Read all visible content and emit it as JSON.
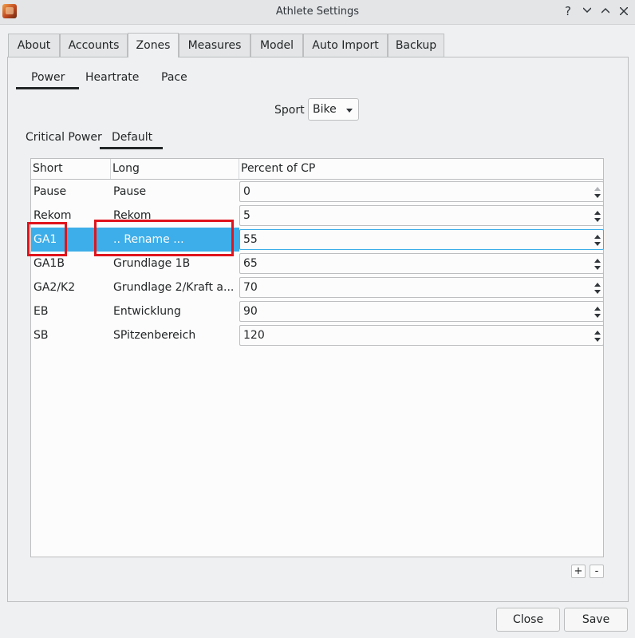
{
  "window": {
    "title": "Athlete Settings",
    "help": "?"
  },
  "tabs": [
    "About",
    "Accounts",
    "Zones",
    "Measures",
    "Model",
    "Auto Import",
    "Backup"
  ],
  "zone_tabs": [
    "Power",
    "Heartrate",
    "Pace"
  ],
  "sport": {
    "label": "Sport",
    "value": "Bike"
  },
  "range_tabs": [
    "Critical Power",
    "Default"
  ],
  "table": {
    "headers": [
      "Short",
      "Long",
      "Percent of CP"
    ],
    "rows": [
      {
        "short": "Pause",
        "long": "Pause",
        "percent": "0"
      },
      {
        "short": "Rekom",
        "long": "Rekom",
        "percent": "5"
      },
      {
        "short": "GA1",
        "long": ".. Rename ...",
        "percent": "55"
      },
      {
        "short": "GA1B",
        "long": "Grundlage 1B",
        "percent": "65"
      },
      {
        "short": "GA2/K2",
        "long": "Grundlage 2/Kraft a...",
        "percent": "70"
      },
      {
        "short": "EB",
        "long": "Entwicklung",
        "percent": "90"
      },
      {
        "short": "SB",
        "long": "SPitzenbereich",
        "percent": "120"
      }
    ]
  },
  "controls": {
    "add": "+",
    "remove": "-"
  },
  "buttons": {
    "close": "Close",
    "save": "Save"
  },
  "colors": {
    "selection": "#3daee9",
    "highlight": "#e0141c"
  }
}
